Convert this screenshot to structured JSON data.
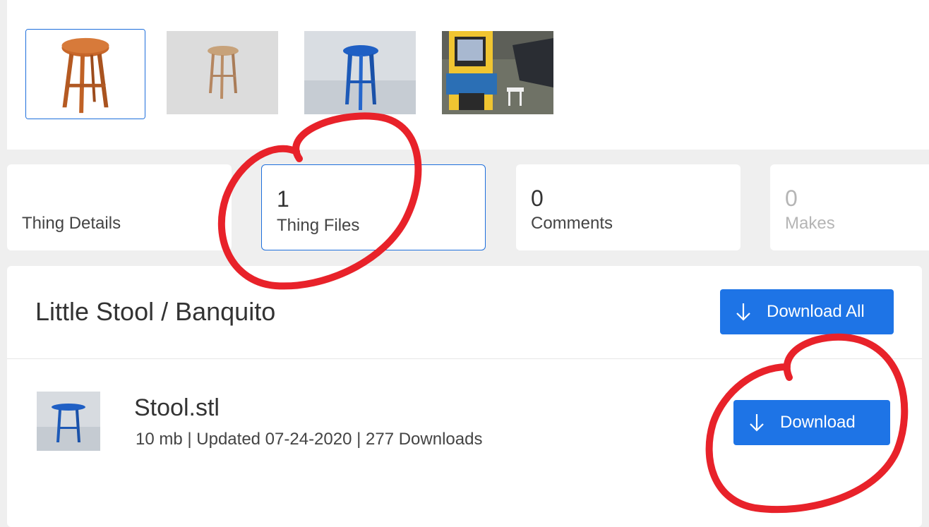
{
  "gallery": {
    "thumbnails": [
      {
        "name": "stool-render-orange"
      },
      {
        "name": "stool-photo-tan"
      },
      {
        "name": "stool-render-blue"
      },
      {
        "name": "arcade-cabinet-photo"
      }
    ]
  },
  "tabs": [
    {
      "count": "",
      "label": "Thing Details"
    },
    {
      "count": "1",
      "label": "Thing Files"
    },
    {
      "count": "0",
      "label": "Comments"
    },
    {
      "count": "0",
      "label": "Makes"
    }
  ],
  "files_panel": {
    "title": "Little Stool / Banquito",
    "download_all_label": "Download All",
    "file": {
      "name": "Stool.stl",
      "meta": "10 mb | Updated 07-24-2020 | 277 Downloads",
      "download_label": "Download"
    }
  },
  "colors": {
    "accent": "#1e74e6",
    "annotation": "#e8222a"
  },
  "icons": {
    "download": "arrow-down-icon"
  }
}
